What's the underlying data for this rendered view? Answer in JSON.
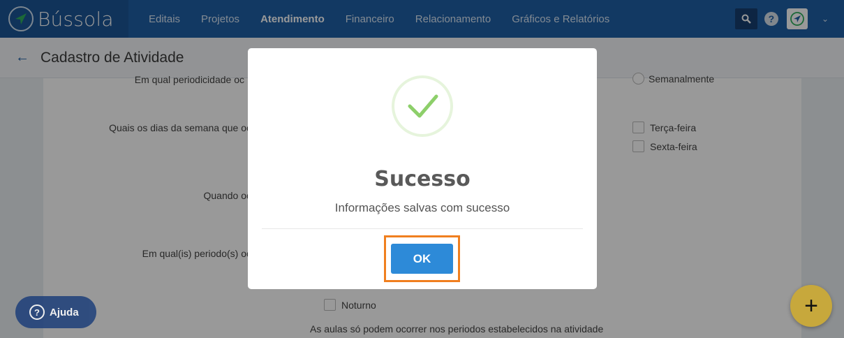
{
  "nav": {
    "logo_text": "Bússola",
    "items": [
      "Editais",
      "Projetos",
      "Atendimento",
      "Financeiro",
      "Relacionamento",
      "Gráficos e Relatórios"
    ],
    "active_index": 2
  },
  "header": {
    "title": "Cadastro de Atividade"
  },
  "form": {
    "q_periodicidade": "Em qual periodicidade oc",
    "opt_semanalmente": "Semanalmente",
    "q_dias": "Quais os dias da semana que oc",
    "opt_terca": "Terça-feira",
    "opt_sexta": "Sexta-feira",
    "q_quando": "Quando oc",
    "q_periodos": "Em qual(is) periodo(s) oc",
    "opt_noturno": "Noturno",
    "note": "As aulas só podem ocorrer nos periodos estabelecidos na atividade"
  },
  "modal": {
    "title": "Sucesso",
    "message": "Informações salvas com sucesso",
    "ok_label": "OK"
  },
  "help_fab": {
    "label": "Ajuda"
  },
  "add_fab": {
    "symbol": "+"
  },
  "colors": {
    "nav_bg": "#1f5fa6",
    "ok_button": "#2d8ad8",
    "highlight": "#f07f1f",
    "success_check": "#8dcf6a",
    "add_fab": "#c7a83c"
  }
}
